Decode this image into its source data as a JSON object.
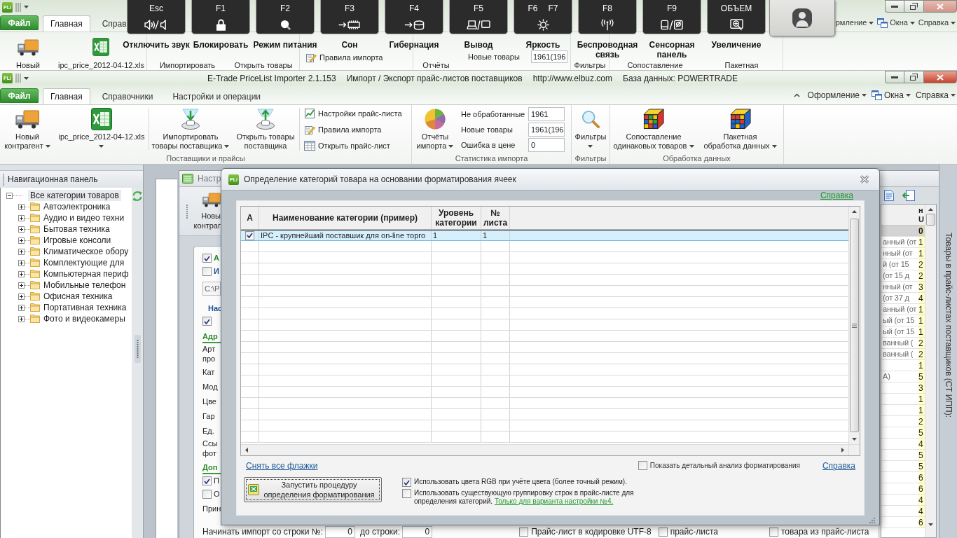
{
  "background_window": {
    "logo": "PLi",
    "tabs": [
      {
        "label": "Файл",
        "kind": "file",
        "selected": false
      },
      {
        "label": "Главная",
        "kind": "tab",
        "selected": true
      },
      {
        "label": "Справ",
        "kind": "tab",
        "selected": false
      }
    ],
    "menu": [
      "рмление",
      "Окна",
      "Справка"
    ],
    "ribbon": [
      {
        "kind": "large",
        "label": "Новый"
      },
      {
        "kind": "large",
        "label": "ipc_price_2012-04-12.xls"
      },
      {
        "kind": "large",
        "label": "Импортировать"
      },
      {
        "kind": "large",
        "label": "Открыть товары"
      },
      {
        "kind": "small",
        "label": "Правила импорта"
      },
      {
        "kind": "large",
        "label": "Отчёты"
      },
      {
        "kind": "stat",
        "label": "Новые товары",
        "value": "1961(196"
      },
      {
        "kind": "large",
        "label": "Фильтры"
      },
      {
        "kind": "large",
        "label": "Сопоставление"
      },
      {
        "kind": "large",
        "label": "Пакетная"
      }
    ]
  },
  "key_overlay": {
    "keys": [
      {
        "labels": [
          "Esc"
        ],
        "caption": [
          "Отключить звук"
        ]
      },
      {
        "labels": [
          "F1"
        ],
        "caption": [
          "Блокировать"
        ]
      },
      {
        "labels": [
          "F2"
        ],
        "caption": [
          "Режим питания"
        ]
      },
      {
        "labels": [
          "F3"
        ],
        "caption": [
          "Сон"
        ]
      },
      {
        "labels": [
          "F4"
        ],
        "caption": [
          "Гибернация"
        ]
      },
      {
        "labels": [
          "F5"
        ],
        "caption": [
          "Вывод"
        ]
      },
      {
        "labels": [
          "F6",
          "F7"
        ],
        "caption": [
          "Яркость"
        ]
      },
      {
        "labels": [
          "F8"
        ],
        "caption": [
          "Беспроводная",
          "связь"
        ]
      },
      {
        "labels": [
          "F9"
        ],
        "caption": [
          "Сенсорная",
          "панель"
        ]
      },
      {
        "labels": [
          "ОБЪЕМ"
        ],
        "caption": [
          "Увеличение"
        ]
      }
    ]
  },
  "window": {
    "logo": "PLi",
    "title": [
      "E-Trade PriceList Importer 2.1.153",
      "Импорт / Экспорт прайс-листов поставщиков",
      "http://www.elbuz.com",
      "База данных: POWERTRADE"
    ]
  },
  "menu_tabs": [
    {
      "label": "Файл",
      "kind": "file",
      "selected": false
    },
    {
      "label": "Главная",
      "kind": "tab",
      "selected": true
    },
    {
      "label": "Справочники",
      "kind": "tab",
      "selected": false
    },
    {
      "label": "Настройки и операции",
      "kind": "tab",
      "selected": false
    }
  ],
  "menu": [
    "Оформление",
    "Окна",
    "Справка"
  ],
  "ribbon": {
    "groups": [
      {
        "label": "Поставщики и прайсы",
        "items": [
          {
            "kind": "large",
            "lines": [
              "Новый",
              "контрагент"
            ],
            "dropdown": true
          },
          {
            "kind": "large",
            "lines": [
              "ipc_price_2012-04-12.xls"
            ],
            "dropdown": true
          },
          {
            "kind": "large",
            "lines": [
              "Импортировать",
              "товары поставщика"
            ],
            "dropdown": true
          },
          {
            "kind": "large",
            "lines": [
              "Открыть товары",
              "поставщика"
            ],
            "dropdown": false
          },
          {
            "kind": "list",
            "entries": [
              "Настройки прайс-листа",
              "Правила импорта",
              "Открыть прайс-лист"
            ]
          }
        ]
      },
      {
        "label": "Статистика импорта",
        "items": [
          {
            "kind": "large",
            "lines": [
              "Отчёты",
              "импорта"
            ],
            "dropdown": true
          },
          {
            "kind": "stats",
            "entries": [
              {
                "label": "Не обработанные",
                "value": "1961"
              },
              {
                "label": "Новые товары",
                "value": "1961(196"
              },
              {
                "label": "Ошибка в цене",
                "value": "0"
              }
            ]
          }
        ]
      },
      {
        "label": "Фильтры",
        "items": [
          {
            "kind": "large",
            "lines": [
              "Фильтры"
            ],
            "dropdown": true
          }
        ]
      },
      {
        "label": "Обработка данных",
        "items": [
          {
            "kind": "large",
            "lines": [
              "Сопоставление",
              "одинаковых товаров"
            ],
            "dropdown": true
          },
          {
            "kind": "large",
            "lines": [
              "Пакетная",
              "обработка данных"
            ],
            "dropdown": true
          }
        ]
      }
    ]
  },
  "navigation": {
    "title": "Навигационная панель",
    "tree": [
      {
        "label": "Все категории товаров",
        "expanded": true,
        "selected": true,
        "children": [
          {
            "label": "Автоэлектроника",
            "expanded": false,
            "selected": false
          },
          {
            "label": "Аудио и видео техни",
            "expanded": false,
            "selected": false
          },
          {
            "label": "Бытовая техника",
            "expanded": false,
            "selected": false
          },
          {
            "label": "Игровые консоли",
            "expanded": false,
            "selected": false
          },
          {
            "label": "Климатическое обору",
            "expanded": false,
            "selected": false
          },
          {
            "label": "Комплектующие для",
            "expanded": false,
            "selected": false
          },
          {
            "label": "Компьютерная периф",
            "expanded": false,
            "selected": false
          },
          {
            "label": "Мобильные телефон",
            "expanded": false,
            "selected": false
          },
          {
            "label": "Офисная техника",
            "expanded": false,
            "selected": false
          },
          {
            "label": "Портативная техника",
            "expanded": false,
            "selected": false
          },
          {
            "label": "Фото и видеокамеры",
            "expanded": false,
            "selected": false
          }
        ]
      }
    ]
  },
  "document": {
    "tab": "Настр",
    "toolbar_button": [
      "Новы",
      "контраг"
    ],
    "form": [
      {
        "kind": "check",
        "checked": true,
        "label": "А",
        "color": "#2a8a2a"
      },
      {
        "kind": "check",
        "checked": false,
        "label": "И",
        "color": "#1d4f94"
      },
      {
        "kind": "path",
        "value": "C:\\P"
      },
      {
        "kind": "group",
        "label": "Нас"
      },
      {
        "kind": "check",
        "checked": true
      },
      {
        "kind": "section",
        "label": "Адр"
      },
      {
        "kind": "label",
        "lines": [
          "Арт",
          "про"
        ]
      },
      {
        "kind": "label",
        "lines": [
          "Кат"
        ]
      },
      {
        "kind": "label",
        "lines": [
          "Мод"
        ]
      },
      {
        "kind": "label",
        "lines": [
          "Цве"
        ]
      },
      {
        "kind": "label",
        "lines": [
          "Гар"
        ]
      },
      {
        "kind": "label",
        "lines": [
          "Ед."
        ]
      },
      {
        "kind": "label",
        "lines": [
          "Ссы",
          "фот"
        ]
      },
      {
        "kind": "section",
        "label": "Доп"
      },
      {
        "kind": "check",
        "checked": true,
        "label": "П"
      },
      {
        "kind": "check",
        "checked": false,
        "label": "О"
      },
      {
        "kind": "label",
        "lines": [
          "Прин"
        ]
      }
    ],
    "import_range": {
      "from_label": "Начинать импорт со строки №:",
      "from": "0",
      "to_label": "до строки:",
      "to": "0"
    },
    "bottom_options": [
      {
        "label": "Прайс-лист в кодировке UTF-8",
        "checked": false
      },
      {
        "label": "прайс-листа",
        "checked": false
      },
      {
        "label": "товара из прайс-листа",
        "checked": false
      }
    ]
  },
  "side_grid": {
    "header": [
      "н",
      "U"
    ],
    "rows": [
      {
        "value": "0",
        "selected": true
      },
      {
        "text": "анный (от",
        "value": "1",
        "selected": false
      },
      {
        "text": "нный (от",
        "value": "1",
        "selected": false
      },
      {
        "text": "й (от 15",
        "value": "2",
        "selected": false
      },
      {
        "text": "(от 15 д",
        "value": "2",
        "selected": false
      },
      {
        "text": "нный (от",
        "value": "3",
        "selected": false
      },
      {
        "text": "(от 37 д",
        "value": "4",
        "selected": false
      },
      {
        "text": "анный (от",
        "value": "1",
        "selected": false
      },
      {
        "text": "ый (от 15",
        "value": "1",
        "selected": false
      },
      {
        "text": "ый (от 15",
        "value": "1",
        "selected": false
      },
      {
        "text": "ванный (",
        "value": "2",
        "selected": false
      },
      {
        "text": "ванный (",
        "value": "2",
        "selected": false
      },
      {
        "value": "1",
        "selected": false
      },
      {
        "text": "A)",
        "value": "5",
        "selected": false
      },
      {
        "value": "3",
        "selected": false
      },
      {
        "value": "1",
        "selected": false
      },
      {
        "value": "1",
        "selected": false
      },
      {
        "value": "2",
        "selected": false
      },
      {
        "value": "5",
        "selected": false
      },
      {
        "value": "4",
        "selected": false
      },
      {
        "value": "5",
        "selected": false
      },
      {
        "value": "5",
        "selected": false
      },
      {
        "value": "6",
        "selected": false
      },
      {
        "value": "6",
        "selected": false
      },
      {
        "value": "4",
        "selected": false
      },
      {
        "value": "4",
        "selected": false
      },
      {
        "value": "6",
        "selected": false
      }
    ]
  },
  "side_panel_title": "Товары в прайс-листах поставщиков (СТ ИПП):",
  "dialog": {
    "logo": "PLi",
    "title": "Определение категорий товара на основании форматирования ячеек",
    "help_top": "Справка",
    "table": {
      "columns": [
        "А",
        "Наименование категории (пример)",
        "Уровень категории",
        "№ листа"
      ],
      "rows": [
        {
          "checked": true,
          "selected": true,
          "cells": [
            "",
            "IPC - крупнейший поставшик для on-line торго",
            "1",
            "1"
          ]
        }
      ]
    },
    "clear_all": "Снять все флажки",
    "detail_analysis": {
      "label": "Показать детальный анализ форматирования",
      "checked": false
    },
    "help": "Справка",
    "run_button": "Запустить процедуру определения форматирования",
    "options": [
      {
        "label": "Использовать цвета RGB при учёте цвета (более точный режим).",
        "checked": true
      },
      {
        "label": "Использовать существующую группировку строк в прайс-листе для определения категорий.",
        "checked": false,
        "link": "Только для варианта настройки №4."
      }
    ]
  }
}
